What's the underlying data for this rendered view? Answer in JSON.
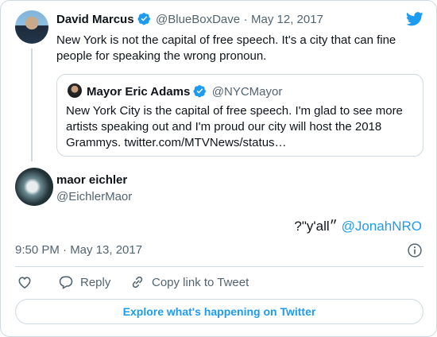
{
  "tweet": {
    "author_name": "David Marcus",
    "author_handle": "@BlueBoxDave",
    "separator": "·",
    "date": "May 12, 2017",
    "text": "New York is not the capital of free speech. It's a city that can fine people for speaking the wrong pronoun."
  },
  "quoted_tweet": {
    "author_name": "Mayor Eric Adams",
    "author_handle": "@NYCMayor",
    "text": "New York City is the capital of free speech. I'm glad to see more artists speaking out and I'm proud our city will host the 2018 Grammys. twitter.com/MTVNews/status…"
  },
  "reply": {
    "author_name": "maor eichler",
    "author_handle": "@EichlerMaor",
    "text": "?\"y'all״",
    "mention": "@JonahNRO",
    "timestamp": "9:50 PM · May 13, 2017"
  },
  "actions": {
    "like_icon": "heart-icon",
    "reply_label": "Reply",
    "copy_link_label": "Copy link to Tweet",
    "explore_label": "Explore what's happening on Twitter"
  },
  "colors": {
    "accent": "#1d9bf0",
    "muted": "#536471",
    "border": "#cfd9de"
  }
}
